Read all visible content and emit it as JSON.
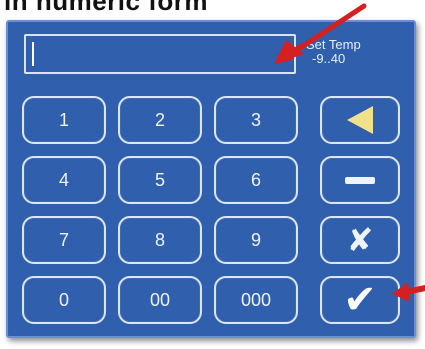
{
  "heading": "in numeric form",
  "display": {
    "value": ""
  },
  "set_temp": {
    "label": "Set Temp",
    "range": "-9..40"
  },
  "keys": {
    "k1": "1",
    "k2": "2",
    "k3": "3",
    "k4": "4",
    "k5": "5",
    "k6": "6",
    "k7": "7",
    "k8": "8",
    "k9": "9",
    "k0": "0",
    "k00": "00",
    "k000": "000"
  },
  "function_keys": {
    "backspace_icon": "left-triangle-icon",
    "minus_icon": "minus-icon",
    "cancel_icon": "cross-icon",
    "confirm_icon": "checkmark-icon",
    "cancel_glyph": "✘",
    "confirm_glyph": "✔"
  },
  "colors": {
    "panel": "#2f5fad",
    "key_border": "#dde6f7",
    "backspace_icon": "#f1e08c",
    "annotation_arrow": "#d42020"
  }
}
